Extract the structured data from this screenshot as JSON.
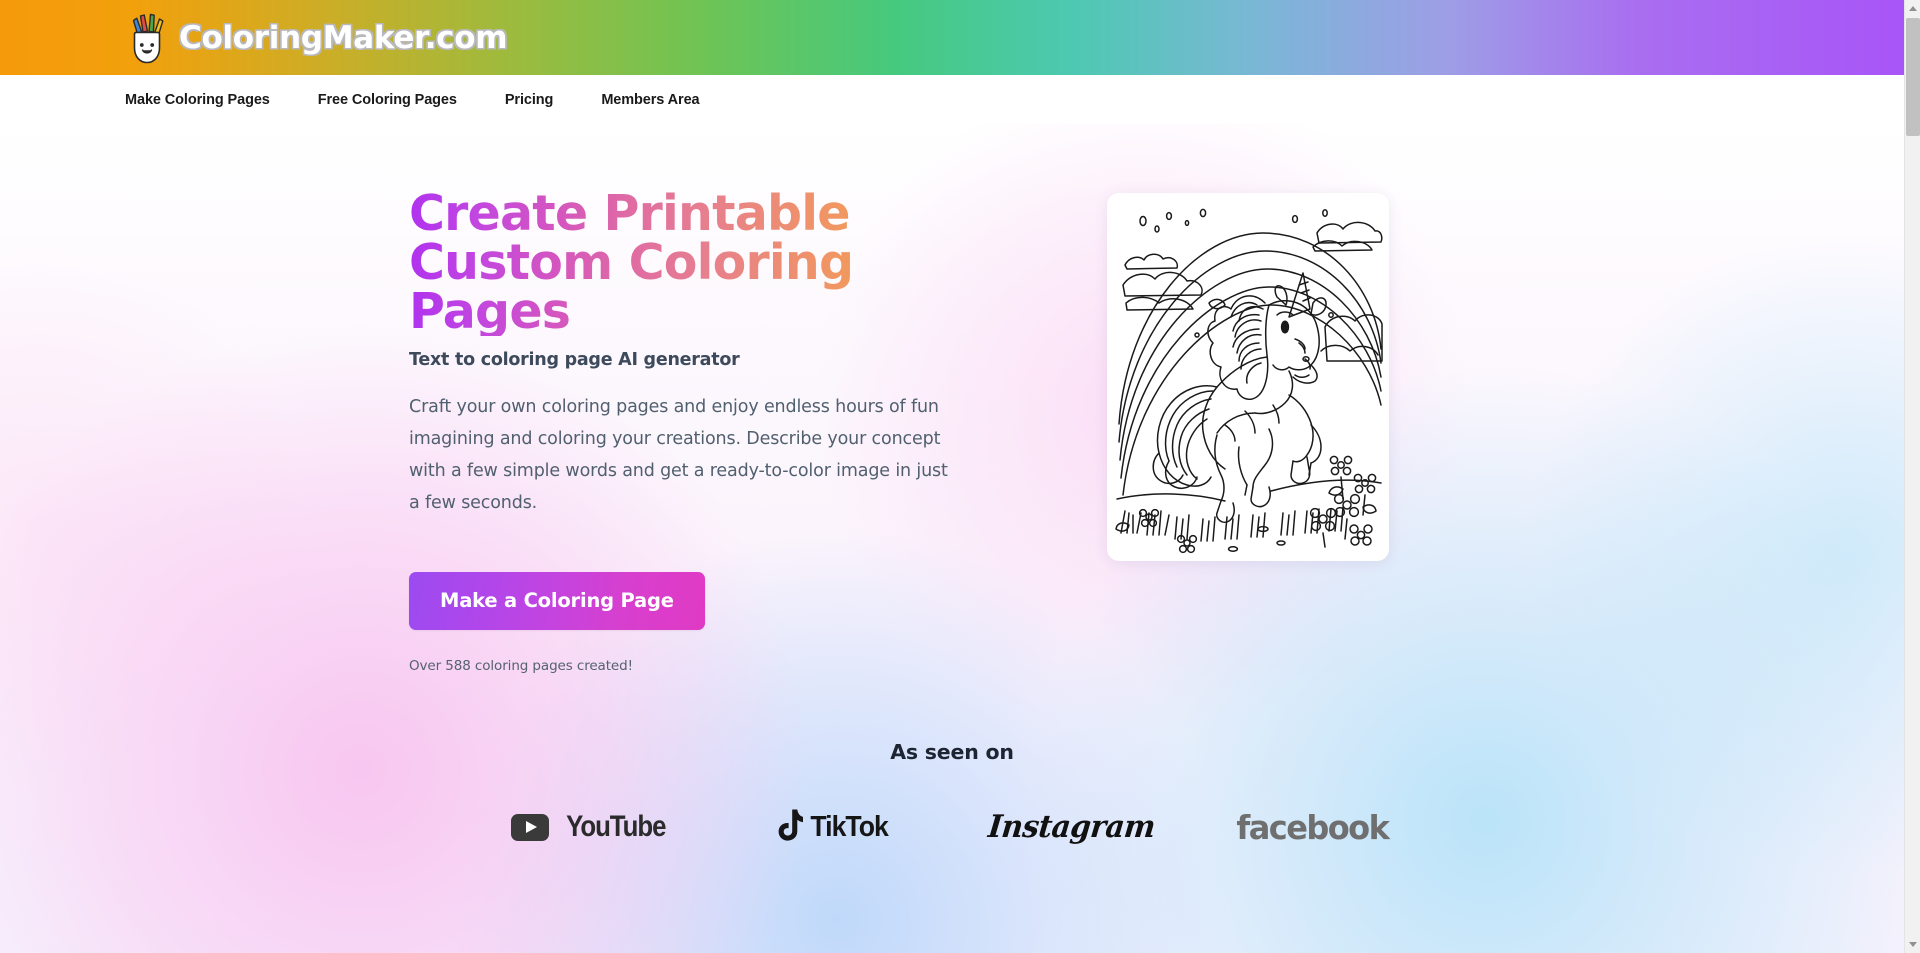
{
  "brand": {
    "name": "ColoringMaker.com",
    "logo_icon": "pencil-cup-smiley-icon",
    "header_gradient": [
      "#f59a0b",
      "#9cbb3e",
      "#46c97e",
      "#4cc9b0",
      "#a855f7"
    ]
  },
  "nav": {
    "items": [
      {
        "label": "Make Coloring Pages",
        "name": "nav-make-coloring-pages"
      },
      {
        "label": "Free Coloring Pages",
        "name": "nav-free-coloring-pages"
      },
      {
        "label": "Pricing",
        "name": "nav-pricing"
      },
      {
        "label": "Members Area",
        "name": "nav-members-area"
      }
    ]
  },
  "hero": {
    "headline": "Create Printable Custom Coloring Pages",
    "headline_gradient": [
      "#b032ef",
      "#e06ca2",
      "#f9ab3c"
    ],
    "subheadline": "Text to coloring page AI generator",
    "paragraph": "Craft your own coloring pages and enjoy endless hours of fun imagining and coloring your creations. Describe your concept with a few simple words and get a ready-to-color image in just a few seconds.",
    "cta_label": "Make a Coloring Page",
    "cta_gradient": [
      "#9b4bf0",
      "#e03ac4"
    ],
    "created_note": "Over 588 coloring pages created!",
    "preview_image_alt": "unicorn-rainbow-coloring-page"
  },
  "as_seen_on": {
    "title": "As seen on",
    "logos": [
      {
        "label": "YouTube",
        "name": "youtube-logo",
        "color": "#2b2b2b"
      },
      {
        "label": "TikTok",
        "name": "tiktok-logo",
        "color": "#161616"
      },
      {
        "label": "Instagram",
        "name": "instagram-logo",
        "color": "#111111"
      },
      {
        "label": "facebook",
        "name": "facebook-logo",
        "color": "#6f6f6f"
      }
    ]
  },
  "scrollbar": {
    "up_arrow": "▲",
    "down_arrow": "▼"
  }
}
